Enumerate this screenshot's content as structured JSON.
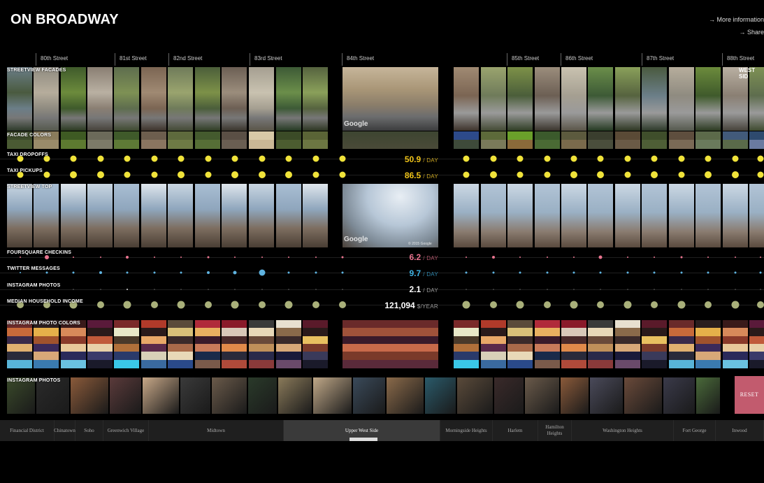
{
  "app": {
    "title": "ON BROADWAY",
    "links": [
      "→ More information",
      "→ Share"
    ]
  },
  "streets": [
    "80th Street",
    "81st Street",
    "82nd Street",
    "83rd Street",
    "84th Street",
    "85th Street",
    "86th Street",
    "87th Street",
    "88th Street"
  ],
  "section_labels": {
    "streetview_facades": "STREETVIEW FACADES",
    "facade_colors": "FACADE COLORS",
    "taxi_dropoffs": "TAXI DROPOFFS",
    "taxi_pickups": "TAXI PICKUPS",
    "streetview_top": "STREETVIEW TOP",
    "foursquare": "FOURSQUARE CHECKINS",
    "twitter": "TWITTER MESSAGES",
    "instagram": "INSTAGRAM PHOTOS",
    "income": "MEDIAN HOUSEHOLD INCOME",
    "photo_colors": "INSTAGRAM PHOTO COLORS",
    "photos": "INSTAGRAM PHOTOS"
  },
  "facade_tag": "WEST SID",
  "image_watermarks": {
    "google": "Google",
    "copyright": "© 2015 Google"
  },
  "stats": {
    "taxi_dropoffs": {
      "value": "50.9",
      "unit": "/ DAY",
      "color": "#f0c419"
    },
    "taxi_pickups": {
      "value": "86.5",
      "unit": "/ DAY",
      "color": "#f0c419"
    },
    "foursquare": {
      "value": "6.2",
      "unit": "/ DAY",
      "color": "#e9748f"
    },
    "twitter": {
      "value": "9.7",
      "unit": "/ DAY",
      "color": "#3fb4e5"
    },
    "instagram": {
      "value": "2.1",
      "unit": "/ DAY",
      "color": "#ffffff"
    },
    "income": {
      "value": "121,094",
      "unit": "$/YEAR",
      "color": "#ffffff"
    }
  },
  "colors": {
    "taxi": "#f0e33a",
    "foursquare": "#e9748f",
    "twitter": "#5fb3e0",
    "instagram": "#dddddd",
    "income": "#a9b07a",
    "reset": "#c25b6e",
    "background": "#000000"
  },
  "reset_label": "RESET",
  "neighborhoods": [
    {
      "label": "Financial District",
      "active": false
    },
    {
      "label": "Chinatown",
      "active": false
    },
    {
      "label": "Soho",
      "active": false
    },
    {
      "label": "Greenwich Village",
      "active": false
    },
    {
      "label": "Midtown",
      "active": false
    },
    {
      "label": "Upper West Side",
      "active": true
    },
    {
      "label": "Morningside Heights",
      "active": false
    },
    {
      "label": "Harlem",
      "active": false
    },
    {
      "label": "Hamilton Heights",
      "active": false
    },
    {
      "label": "Washington Heights",
      "active": false
    },
    {
      "label": "Fort George",
      "active": false
    },
    {
      "label": "Inwood",
      "active": false
    }
  ]
}
